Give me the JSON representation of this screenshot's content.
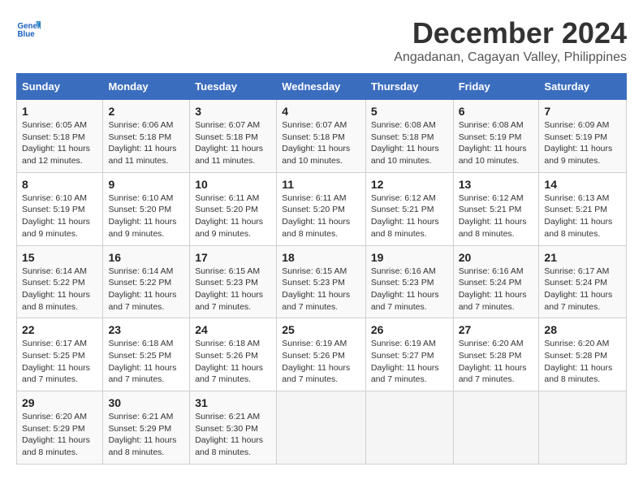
{
  "header": {
    "logo_line1": "General",
    "logo_line2": "Blue",
    "month": "December 2024",
    "location": "Angadanan, Cagayan Valley, Philippines"
  },
  "days_of_week": [
    "Sunday",
    "Monday",
    "Tuesday",
    "Wednesday",
    "Thursday",
    "Friday",
    "Saturday"
  ],
  "weeks": [
    [
      {
        "day": 1,
        "sunrise": "6:05 AM",
        "sunset": "5:18 PM",
        "daylight": "11 hours and 12 minutes."
      },
      {
        "day": 2,
        "sunrise": "6:06 AM",
        "sunset": "5:18 PM",
        "daylight": "11 hours and 11 minutes."
      },
      {
        "day": 3,
        "sunrise": "6:07 AM",
        "sunset": "5:18 PM",
        "daylight": "11 hours and 11 minutes."
      },
      {
        "day": 4,
        "sunrise": "6:07 AM",
        "sunset": "5:18 PM",
        "daylight": "11 hours and 10 minutes."
      },
      {
        "day": 5,
        "sunrise": "6:08 AM",
        "sunset": "5:18 PM",
        "daylight": "11 hours and 10 minutes."
      },
      {
        "day": 6,
        "sunrise": "6:08 AM",
        "sunset": "5:19 PM",
        "daylight": "11 hours and 10 minutes."
      },
      {
        "day": 7,
        "sunrise": "6:09 AM",
        "sunset": "5:19 PM",
        "daylight": "11 hours and 9 minutes."
      }
    ],
    [
      {
        "day": 8,
        "sunrise": "6:10 AM",
        "sunset": "5:19 PM",
        "daylight": "11 hours and 9 minutes."
      },
      {
        "day": 9,
        "sunrise": "6:10 AM",
        "sunset": "5:20 PM",
        "daylight": "11 hours and 9 minutes."
      },
      {
        "day": 10,
        "sunrise": "6:11 AM",
        "sunset": "5:20 PM",
        "daylight": "11 hours and 9 minutes."
      },
      {
        "day": 11,
        "sunrise": "6:11 AM",
        "sunset": "5:20 PM",
        "daylight": "11 hours and 8 minutes."
      },
      {
        "day": 12,
        "sunrise": "6:12 AM",
        "sunset": "5:21 PM",
        "daylight": "11 hours and 8 minutes."
      },
      {
        "day": 13,
        "sunrise": "6:12 AM",
        "sunset": "5:21 PM",
        "daylight": "11 hours and 8 minutes."
      },
      {
        "day": 14,
        "sunrise": "6:13 AM",
        "sunset": "5:21 PM",
        "daylight": "11 hours and 8 minutes."
      }
    ],
    [
      {
        "day": 15,
        "sunrise": "6:14 AM",
        "sunset": "5:22 PM",
        "daylight": "11 hours and 8 minutes."
      },
      {
        "day": 16,
        "sunrise": "6:14 AM",
        "sunset": "5:22 PM",
        "daylight": "11 hours and 7 minutes."
      },
      {
        "day": 17,
        "sunrise": "6:15 AM",
        "sunset": "5:23 PM",
        "daylight": "11 hours and 7 minutes."
      },
      {
        "day": 18,
        "sunrise": "6:15 AM",
        "sunset": "5:23 PM",
        "daylight": "11 hours and 7 minutes."
      },
      {
        "day": 19,
        "sunrise": "6:16 AM",
        "sunset": "5:23 PM",
        "daylight": "11 hours and 7 minutes."
      },
      {
        "day": 20,
        "sunrise": "6:16 AM",
        "sunset": "5:24 PM",
        "daylight": "11 hours and 7 minutes."
      },
      {
        "day": 21,
        "sunrise": "6:17 AM",
        "sunset": "5:24 PM",
        "daylight": "11 hours and 7 minutes."
      }
    ],
    [
      {
        "day": 22,
        "sunrise": "6:17 AM",
        "sunset": "5:25 PM",
        "daylight": "11 hours and 7 minutes."
      },
      {
        "day": 23,
        "sunrise": "6:18 AM",
        "sunset": "5:25 PM",
        "daylight": "11 hours and 7 minutes."
      },
      {
        "day": 24,
        "sunrise": "6:18 AM",
        "sunset": "5:26 PM",
        "daylight": "11 hours and 7 minutes."
      },
      {
        "day": 25,
        "sunrise": "6:19 AM",
        "sunset": "5:26 PM",
        "daylight": "11 hours and 7 minutes."
      },
      {
        "day": 26,
        "sunrise": "6:19 AM",
        "sunset": "5:27 PM",
        "daylight": "11 hours and 7 minutes."
      },
      {
        "day": 27,
        "sunrise": "6:20 AM",
        "sunset": "5:28 PM",
        "daylight": "11 hours and 7 minutes."
      },
      {
        "day": 28,
        "sunrise": "6:20 AM",
        "sunset": "5:28 PM",
        "daylight": "11 hours and 8 minutes."
      }
    ],
    [
      {
        "day": 29,
        "sunrise": "6:20 AM",
        "sunset": "5:29 PM",
        "daylight": "11 hours and 8 minutes."
      },
      {
        "day": 30,
        "sunrise": "6:21 AM",
        "sunset": "5:29 PM",
        "daylight": "11 hours and 8 minutes."
      },
      {
        "day": 31,
        "sunrise": "6:21 AM",
        "sunset": "5:30 PM",
        "daylight": "11 hours and 8 minutes."
      },
      null,
      null,
      null,
      null
    ]
  ]
}
